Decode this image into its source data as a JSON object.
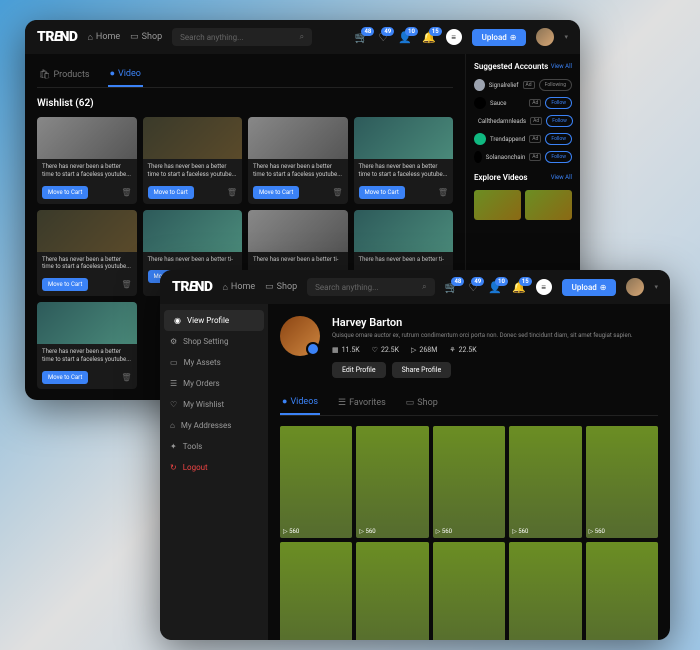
{
  "brand": "TREND",
  "nav": {
    "home": "Home",
    "shop": "Shop"
  },
  "search": {
    "placeholder": "Search anything..."
  },
  "header_badges": [
    "48",
    "49",
    "10",
    "15"
  ],
  "upload_label": "Upload",
  "w1": {
    "tabs": {
      "products": "Products",
      "video": "Video"
    },
    "wishlist_title": "Wishlist (62)",
    "card_title": "There has never been a better time to start a faceless youtube...",
    "card_title_short": "There has never been a better ti-",
    "cart_label": "Move to Cart",
    "suggested": {
      "title": "Suggested Accounts",
      "view": "View All"
    },
    "accounts": [
      {
        "name": "Signalrelief",
        "action": "Following"
      },
      {
        "name": "Sauce",
        "action": "Follow"
      },
      {
        "name": "Callthedamnleads",
        "action": "Follow"
      },
      {
        "name": "Trendappend",
        "action": "Follow"
      },
      {
        "name": "Solanaonchain",
        "action": "Follow"
      }
    ],
    "explore": {
      "title": "Explore Videos",
      "view": "View All"
    }
  },
  "w2": {
    "menu": [
      {
        "label": "View Profile",
        "icon": "◉"
      },
      {
        "label": "Shop Setting",
        "icon": "⚙"
      },
      {
        "label": "My Assets",
        "icon": "▭"
      },
      {
        "label": "My Orders",
        "icon": "☰"
      },
      {
        "label": "My Wishlist",
        "icon": "♡"
      },
      {
        "label": "My Addresses",
        "icon": "⌂"
      },
      {
        "label": "Tools",
        "icon": "✦"
      },
      {
        "label": "Logout",
        "icon": "↻"
      }
    ],
    "profile": {
      "name": "Harvey Barton",
      "bio": "Quisque ornare auctor ex, rutrum condimentum orci porta non. Donec sed tincidunt diam, sit amet feugiat sapien.",
      "stats": {
        "posts": "11.5K",
        "likes": "22.5K",
        "views": "268M",
        "followers": "22.5K"
      },
      "edit": "Edit Profile",
      "share": "Share Profile"
    },
    "tabs": {
      "videos": "Videos",
      "favorites": "Favorites",
      "shop": "Shop"
    },
    "video_plays": "560"
  }
}
